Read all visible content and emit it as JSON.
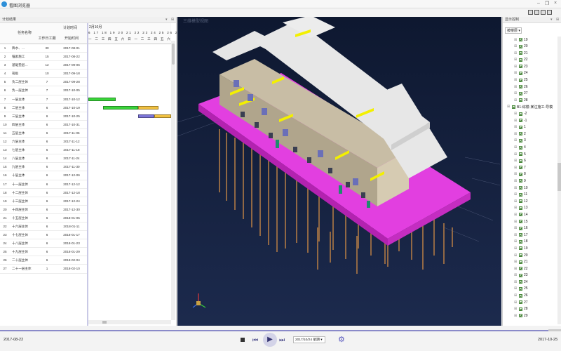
{
  "app": {
    "title": "看图浏览器"
  },
  "left_panel": {
    "title": "计划结果",
    "col_task_name": "任务名称",
    "col_plan_time": "计划时间",
    "col_duration": "工作日工期",
    "col_start": "开始时间",
    "month_label": "2月10月",
    "days": "6 17 18 19 20 21 22 23 24 25 26 27 28",
    "weekdays": "一 二 三 四 五 六 日 一 二 三 四 五 六",
    "rows": [
      {
        "id": "1",
        "name": "降水、…",
        "duration": "30",
        "start": "2017-08-01"
      },
      {
        "id": "2",
        "name": "锚索施工",
        "duration": "15",
        "start": "2017-08-22"
      },
      {
        "id": "3",
        "name": "基础垫层…",
        "duration": "12",
        "start": "2017-09-06"
      },
      {
        "id": "4",
        "name": "筏板",
        "duration": "10",
        "start": "2017-09-18"
      },
      {
        "id": "5",
        "name": "负二层主体",
        "duration": "7",
        "start": "2017-09-28"
      },
      {
        "id": "6",
        "name": "负一层主体",
        "duration": "7",
        "start": "2017-10-05"
      },
      {
        "id": "7",
        "name": "一层主体",
        "duration": "7",
        "start": "2017-10-12"
      },
      {
        "id": "8",
        "name": "二层主体",
        "duration": "6",
        "start": "2017-10-19"
      },
      {
        "id": "9",
        "name": "三层主体",
        "duration": "6",
        "start": "2017-10-25"
      },
      {
        "id": "10",
        "name": "四层主体",
        "duration": "6",
        "start": "2017-10-31"
      },
      {
        "id": "11",
        "name": "五层主体",
        "duration": "6",
        "start": "2017-11-06"
      },
      {
        "id": "12",
        "name": "六层主体",
        "duration": "6",
        "start": "2017-11-12"
      },
      {
        "id": "13",
        "name": "七层主体",
        "duration": "6",
        "start": "2017-11-18"
      },
      {
        "id": "14",
        "name": "八层主体",
        "duration": "6",
        "start": "2017-11-24"
      },
      {
        "id": "15",
        "name": "九层主体",
        "duration": "6",
        "start": "2017-11-30"
      },
      {
        "id": "16",
        "name": "十层主体",
        "duration": "6",
        "start": "2017-12-06"
      },
      {
        "id": "17",
        "name": "十一层主体",
        "duration": "6",
        "start": "2017-12-12"
      },
      {
        "id": "18",
        "name": "十二层主体",
        "duration": "6",
        "start": "2017-12-18"
      },
      {
        "id": "19",
        "name": "十三层主体",
        "duration": "6",
        "start": "2017-12-24"
      },
      {
        "id": "20",
        "name": "十四层主体",
        "duration": "6",
        "start": "2017-12-30"
      },
      {
        "id": "21",
        "name": "十五层主体",
        "duration": "6",
        "start": "2018-01-05"
      },
      {
        "id": "22",
        "name": "十六层主体",
        "duration": "6",
        "start": "2018-01-11"
      },
      {
        "id": "23",
        "name": "十七层主体",
        "duration": "6",
        "start": "2018-01-17"
      },
      {
        "id": "24",
        "name": "十八层主体",
        "duration": "6",
        "start": "2018-01-23"
      },
      {
        "id": "25",
        "name": "十九层主体",
        "duration": "6",
        "start": "2018-01-29"
      },
      {
        "id": "26",
        "name": "二十层主体",
        "duration": "6",
        "start": "2018-02-04"
      },
      {
        "id": "27",
        "name": "二十一层主体",
        "duration": "1",
        "start": "2018-02-10"
      }
    ]
  },
  "gantt_bars": [
    {
      "row": 7,
      "start": 0,
      "end": 0.33,
      "color": "#3ad43a"
    },
    {
      "row": 8,
      "start": 0.18,
      "end": 0.6,
      "color": "#3ad43a"
    },
    {
      "row": 8,
      "start": 0.6,
      "end": 0.85,
      "color": "#f0c040"
    },
    {
      "row": 9,
      "start": 0.6,
      "end": 0.8,
      "color": "#7b74d6"
    },
    {
      "row": 9,
      "start": 0.8,
      "end": 1.0,
      "color": "#f0c040"
    }
  ],
  "viewport": {
    "label": "三维模型视图"
  },
  "right_panel": {
    "title": "显示控制",
    "filter_value": "按楼层",
    "group_label": "B1-综楼-某注施工-导模",
    "items_top": [
      "19",
      "20",
      "21",
      "22",
      "23",
      "24",
      "25",
      "26",
      "27",
      "28"
    ],
    "items_bottom": [
      "-2",
      "-1",
      "1",
      "2",
      "3",
      "4",
      "5",
      "6",
      "7",
      "8",
      "9",
      "10",
      "11",
      "12",
      "13",
      "14",
      "15",
      "16",
      "17",
      "18",
      "19",
      "20",
      "21",
      "22",
      "23",
      "24",
      "25",
      "26",
      "27",
      "28",
      "29"
    ]
  },
  "bottom": {
    "start_date": "2017-08-22",
    "end_date": "2017-10-25",
    "current_date": "2017/10/24 星期",
    "progress": 0.98
  },
  "colors": {
    "accent": "#8a8ac9",
    "platform": "#e23fe0",
    "background": "#121c36"
  }
}
